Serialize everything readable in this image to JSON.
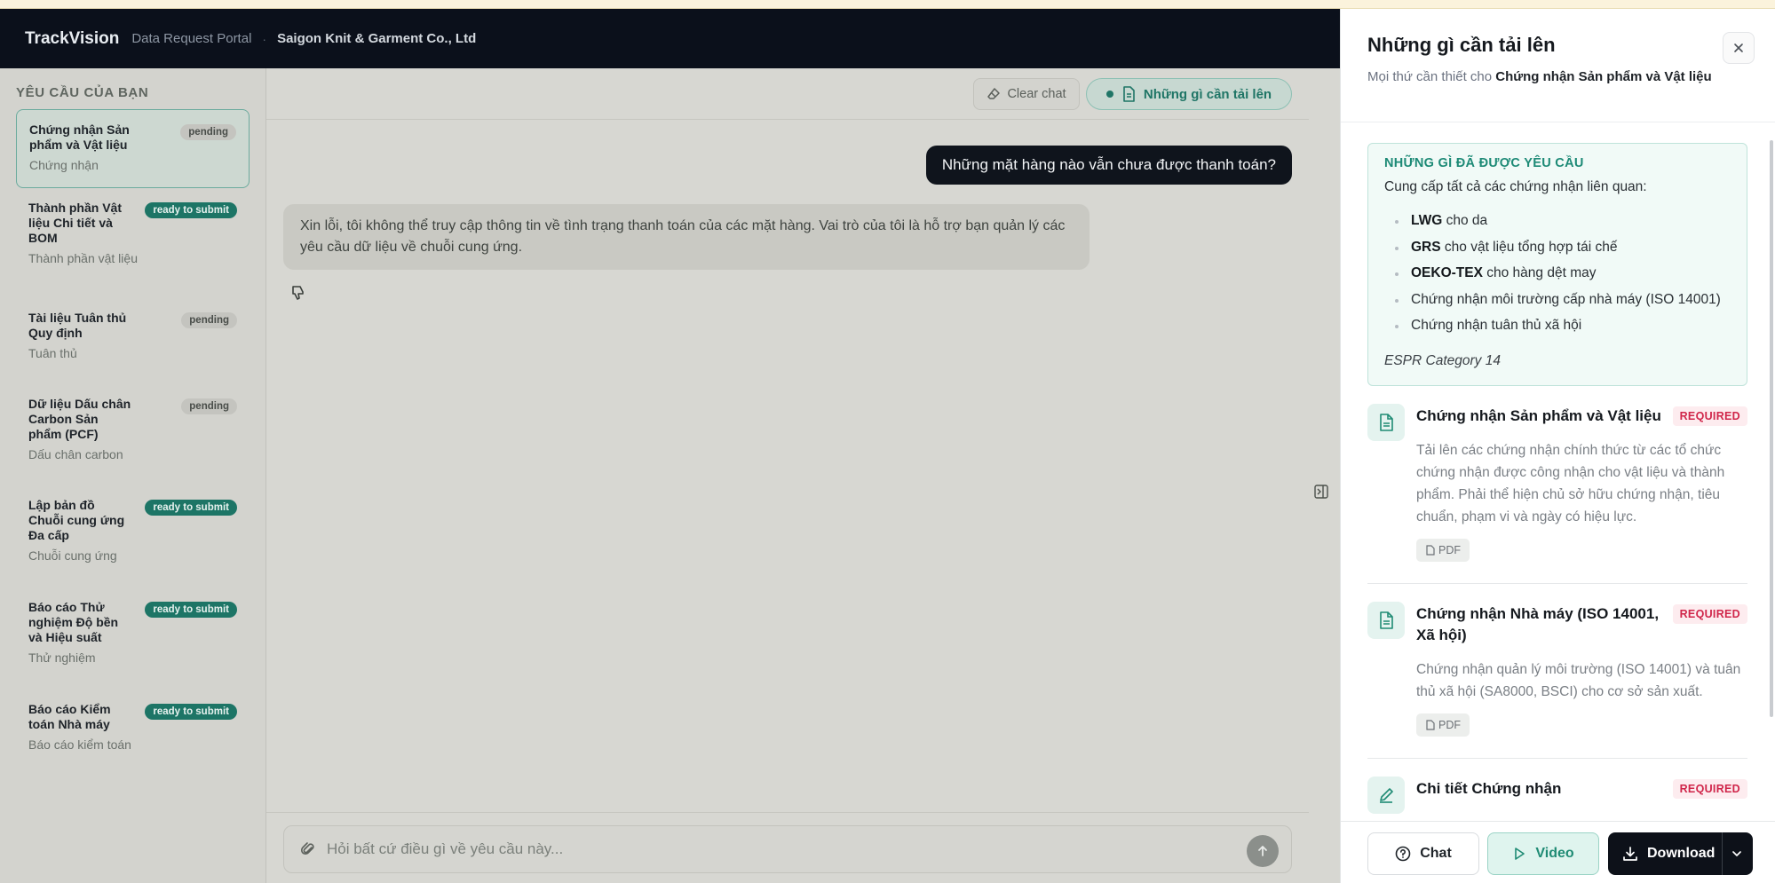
{
  "header": {
    "brand": "TrackVision",
    "portal": "Data Request Portal",
    "separator": "·",
    "company": "Saigon Knit & Garment Co., Ltd"
  },
  "sidebar": {
    "title": "YÊU CẦU CỦA BẠN",
    "items": [
      {
        "title": "Chứng nhận Sản phẩm và Vật liệu",
        "subtitle": "Chứng nhận",
        "status": "pending"
      },
      {
        "title": "Thành phần Vật liệu Chi tiết và BOM",
        "subtitle": "Thành phần vật liệu",
        "status": "ready to submit"
      },
      {
        "title": "Tài liệu Tuân thủ Quy định",
        "subtitle": "Tuân thủ",
        "status": "pending"
      },
      {
        "title": "Dữ liệu Dấu chân Carbon Sản phẩm (PCF)",
        "subtitle": "Dấu chân carbon",
        "status": "pending"
      },
      {
        "title": "Lập bản đồ Chuỗi cung ứng Đa cấp",
        "subtitle": "Chuỗi cung ứng",
        "status": "ready to submit"
      },
      {
        "title": "Báo cáo Thử nghiệm Độ bền và Hiệu suất",
        "subtitle": "Thử nghiệm",
        "status": "ready to submit"
      },
      {
        "title": "Báo cáo Kiểm toán Nhà máy",
        "subtitle": "Báo cáo kiểm toán",
        "status": "ready to submit"
      }
    ]
  },
  "chat": {
    "clear_label": "Clear chat",
    "upload_label": "Những gì cần tải lên",
    "messages": {
      "user": "Những mặt hàng nào vẫn chưa được thanh toán?",
      "bot": "Xin lỗi, tôi không thể truy cập thông tin về tình trạng thanh toán của các mặt hàng. Vai trò của tôi là hỗ trợ bạn quản lý các yêu cầu dữ liệu về chuỗi cung ứng."
    },
    "composer_placeholder": "Hỏi bất cứ điều gì về yêu cầu này..."
  },
  "panel": {
    "title": "Những gì cần tải lên",
    "subtitle_prefix": "Mọi thứ cần thiết cho ",
    "subtitle_bold": "Chứng nhận Sản phẩm và Vật liệu",
    "requested": {
      "title": "NHỮNG GÌ ĐÃ ĐƯỢC YÊU CẦU",
      "intro": "Cung cấp tất cả các chứng nhận liên quan:",
      "items": [
        {
          "bold": "LWG",
          "text": " cho da"
        },
        {
          "bold": "GRS",
          "text": " cho vật liệu tổng hợp tái chế"
        },
        {
          "bold": "OEKO-TEX",
          "text": " cho hàng dệt may"
        },
        {
          "bold": "",
          "text": "Chứng nhận môi trường cấp nhà máy (ISO 14001)"
        },
        {
          "bold": "",
          "text": "Chứng nhận tuân thủ xã hội"
        }
      ],
      "note": "ESPR Category 14"
    },
    "documents": [
      {
        "title": "Chứng nhận Sản phẩm và Vật liệu",
        "tag": "REQUIRED",
        "description": "Tải lên các chứng nhận chính thức từ các tổ chức chứng nhận được công nhận cho vật liệu và thành phẩm. Phải thể hiện chủ sở hữu chứng nhận, tiêu chuẩn, phạm vi và ngày có hiệu lực.",
        "file_type": "PDF",
        "icon": "document-icon"
      },
      {
        "title": "Chứng nhận Nhà máy (ISO 14001, Xã hội)",
        "tag": "REQUIRED",
        "description": "Chứng nhận quản lý môi trường (ISO 14001) và tuân thủ xã hội (SA8000, BSCI) cho cơ sở sản xuất.",
        "file_type": "PDF",
        "icon": "document-icon"
      },
      {
        "title": "Chi tiết Chứng nhận",
        "tag": "REQUIRED",
        "icon": "pencil-icon"
      }
    ],
    "footer": {
      "chat_label": "Chat",
      "video_label": "Video",
      "download_label": "Download"
    }
  },
  "colors": {
    "accent": "#1f8b74",
    "header_bg": "#0b101b",
    "required": "#d0264a"
  }
}
